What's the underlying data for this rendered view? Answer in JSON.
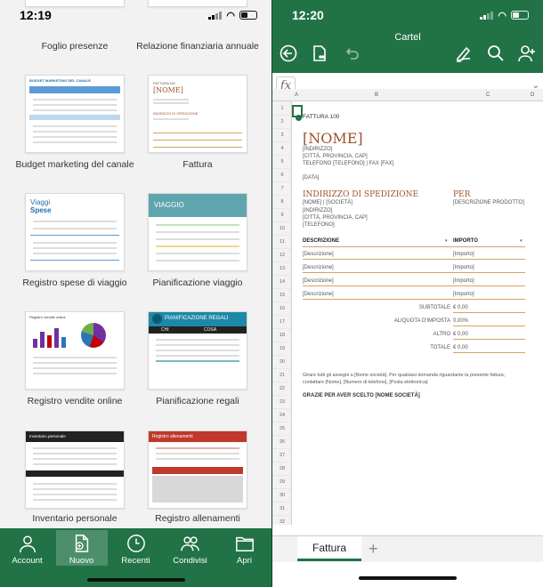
{
  "left": {
    "time": "12:19",
    "top_labels": [
      "Foglio presenze",
      "Relazione finanziaria annuale"
    ],
    "templates": [
      {
        "label": "Budget marketing del canale",
        "header": "BUDGET MARKETING DEL CANALE"
      },
      {
        "label": "Fattura",
        "header": "FATTURA NO",
        "name": "[NOME]",
        "ship": "INDIRIZZO DI SPEDIZIONE"
      },
      {
        "label": "Registro spese di viaggio",
        "header": "Viaggi",
        "sub": "Spese"
      },
      {
        "label": "Pianificazione viaggio",
        "header": "VIAGGIO"
      },
      {
        "label": "Registro vendite online",
        "header": "Registro vendite online"
      },
      {
        "label": "Pianificazione regali",
        "header": "PIANIFICAZIONE REGALI",
        "col1": "CHI",
        "col2": "COSA"
      },
      {
        "label": "Inventario personale",
        "header": "Inventario personale"
      },
      {
        "label": "Registro allenamenti",
        "header": "Registro allenamenti"
      }
    ],
    "tabs": [
      {
        "label": "Account",
        "icon": "person-icon"
      },
      {
        "label": "Nuovo",
        "icon": "new-file-icon"
      },
      {
        "label": "Recenti",
        "icon": "clock-icon"
      },
      {
        "label": "Condivisi",
        "icon": "people-icon"
      },
      {
        "label": "Apri",
        "icon": "folder-icon"
      }
    ]
  },
  "right": {
    "time": "12:20",
    "title": "Cartel",
    "fx": "fx",
    "columns": [
      "A",
      "B",
      "C",
      "D"
    ],
    "sheet_tab": "Fattura",
    "invoice": {
      "heading": "FATTURA 100",
      "name": "[NOME]",
      "addr1": "[INDIRIZZO]",
      "addr2": "[CITTÀ, PROVINCIA, CAP]",
      "phone": "TELEFONO [TELEFONO] | FAX [FAX]",
      "date": "[DATA]",
      "ship_title": "INDIRIZZO DI SPEDIZIONE",
      "per_title": "PER",
      "per_desc": "[DESCRIZIONE PRODOTTO]",
      "ship1": "[NOME] | [SOCIETÀ]",
      "ship2": "[INDIRIZZO]",
      "ship3": "[CITTÀ, PROVINCIA, CAP]",
      "ship4": "[TELEFONO]",
      "col_desc": "DESCRIZIONE",
      "col_amount": "IMPORTO",
      "line_desc": "[Descrizione]",
      "line_amount": "[Importo]",
      "subtotal_label": "SUBTOTALE",
      "subtotal_value": "€ 0,00",
      "tax_label": "ALIQUOTA D'IMPOSTA",
      "tax_value": "0,00%",
      "other_label": "ALTRO",
      "other_value": "€ 0,00",
      "total_label": "TOTALE",
      "total_value": "€ 0,00",
      "note1": "Girare tutti gli assegni a [Nome società]. Per qualsiasi domanda riguardante la presente fattura,",
      "note2": "contattare [Nome], [Numero di telefono], [Posta elettronica]",
      "thanks": "GRAZIE PER AVER SCELTO [NOME SOCIETÀ]"
    }
  }
}
